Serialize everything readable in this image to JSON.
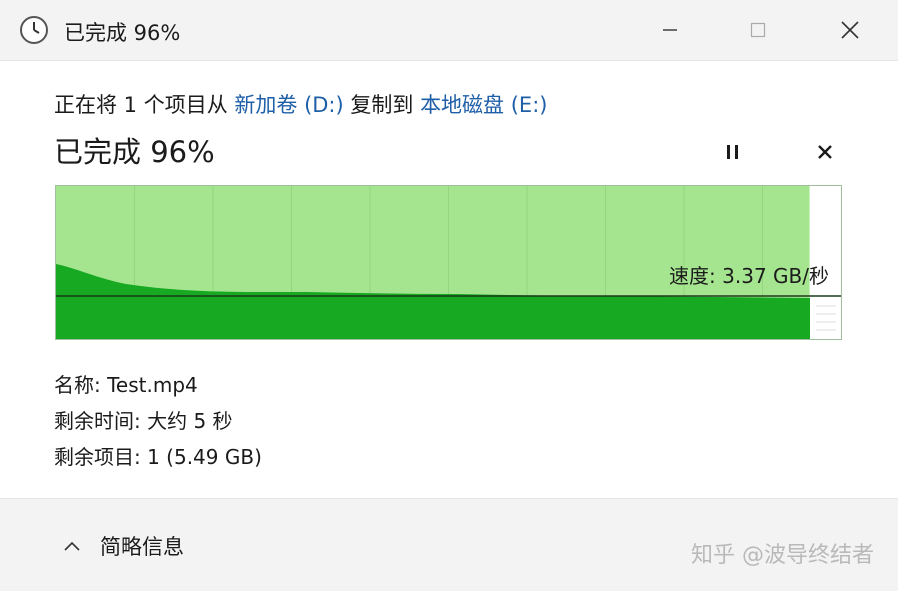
{
  "window": {
    "title": "已完成 96%",
    "icon": "clock-icon"
  },
  "copy_line": {
    "prefix": "正在将 1 个项目从 ",
    "source": "新加卷 (D:)",
    "middle": " 复制到 ",
    "destination": "本地磁盘 (E:)"
  },
  "progress": {
    "title": "已完成 96%",
    "percent": 96
  },
  "speed": {
    "label": "速度: 3.37 GB/秒"
  },
  "info": {
    "name": "名称: Test.mp4",
    "time_remaining": "剩余时间: 大约 5 秒",
    "items_remaining": "剩余项目: 1 (5.49 GB)"
  },
  "footer": {
    "details_label": "简略信息"
  },
  "watermark": "知乎 @波导终结者",
  "colors": {
    "light_green": "#a6e590",
    "dark_green": "#16a921",
    "link": "#1f5fa8"
  }
}
